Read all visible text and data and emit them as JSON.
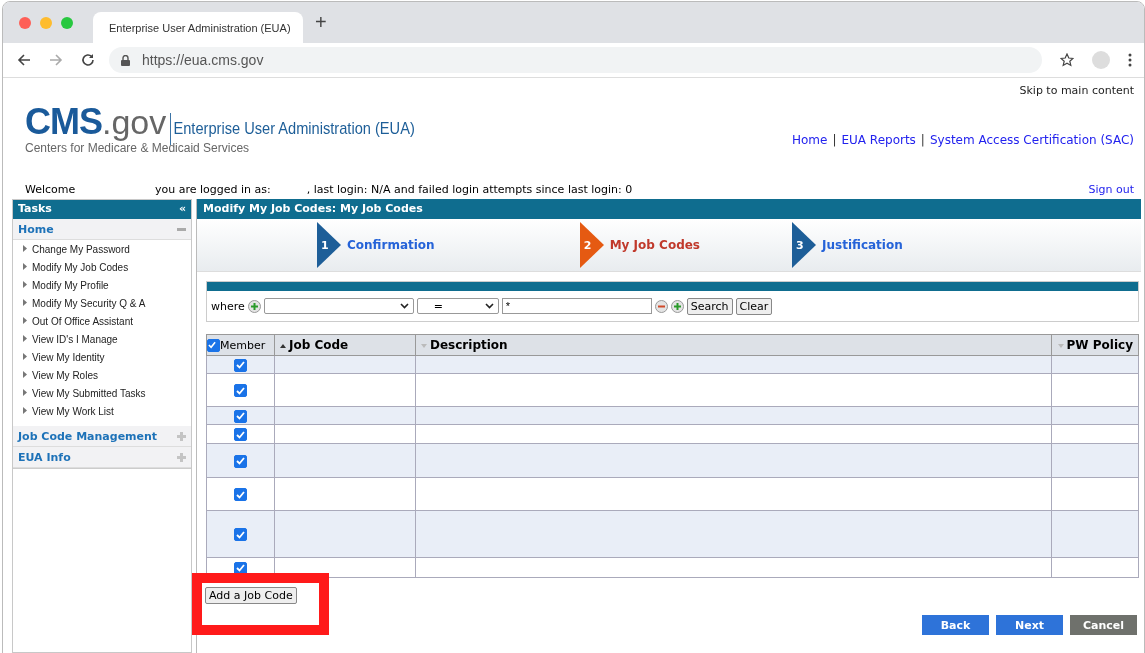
{
  "browser": {
    "tab_title": "Enterprise User Administration (EUA)",
    "new_tab": "+",
    "url": "https://eua.cms.gov"
  },
  "header": {
    "skip_link": "Skip to main content",
    "logo_main": "CMS",
    "logo_suffix": ".gov",
    "logo_tagline": "Centers for Medicare & Medicaid Services",
    "app_title": "Enterprise User Administration (EUA)",
    "links": [
      "Home",
      "EUA Reports",
      "System Access Certification (SAC)"
    ],
    "separator": "|"
  },
  "welcome": {
    "greeting": "Welcome",
    "login_info": "you are logged in as:",
    "last_login": ", last login: N/A and failed login attempts since last login: 0",
    "sign_out": "Sign out"
  },
  "sidebar": {
    "title": "Tasks",
    "collapse": "«",
    "sections": [
      {
        "label": "Home",
        "expanded": true,
        "items": [
          "Change My Password",
          "Modify My Job Codes",
          "Modify My Profile",
          "Modify My Security Q & A",
          "Out Of Office Assistant",
          "View ID's I Manage",
          "View My Identity",
          "View My Roles",
          "View My Submitted Tasks",
          "View My Work List"
        ]
      },
      {
        "label": "Job Code Management",
        "expanded": false
      },
      {
        "label": "EUA Info",
        "expanded": false
      }
    ]
  },
  "panel": {
    "title": "Modify My Job Codes: My Job Codes",
    "steps": [
      {
        "number": "1",
        "label": "Confirmation",
        "selected": false
      },
      {
        "number": "2",
        "label": "My Job Codes",
        "selected": true
      },
      {
        "number": "3",
        "label": "Justification",
        "selected": false
      }
    ],
    "filter": {
      "label": "where",
      "operator": "=",
      "value": "*",
      "search": "Search",
      "clear": "Clear"
    },
    "table": {
      "columns": [
        "Member",
        "Job Code",
        "Description",
        "PW Policy"
      ],
      "all_checked": true,
      "rows": [
        {
          "checked": true
        },
        {
          "checked": true
        },
        {
          "checked": true
        },
        {
          "checked": true
        },
        {
          "checked": true
        },
        {
          "checked": true
        },
        {
          "checked": true
        },
        {
          "checked": true
        }
      ]
    },
    "add_button": "Add a Job Code",
    "highlighted": true,
    "buttons": [
      {
        "label": "Back",
        "kind": "primary"
      },
      {
        "label": "Next",
        "kind": "primary"
      },
      {
        "label": "Cancel",
        "kind": "secondary"
      }
    ]
  }
}
